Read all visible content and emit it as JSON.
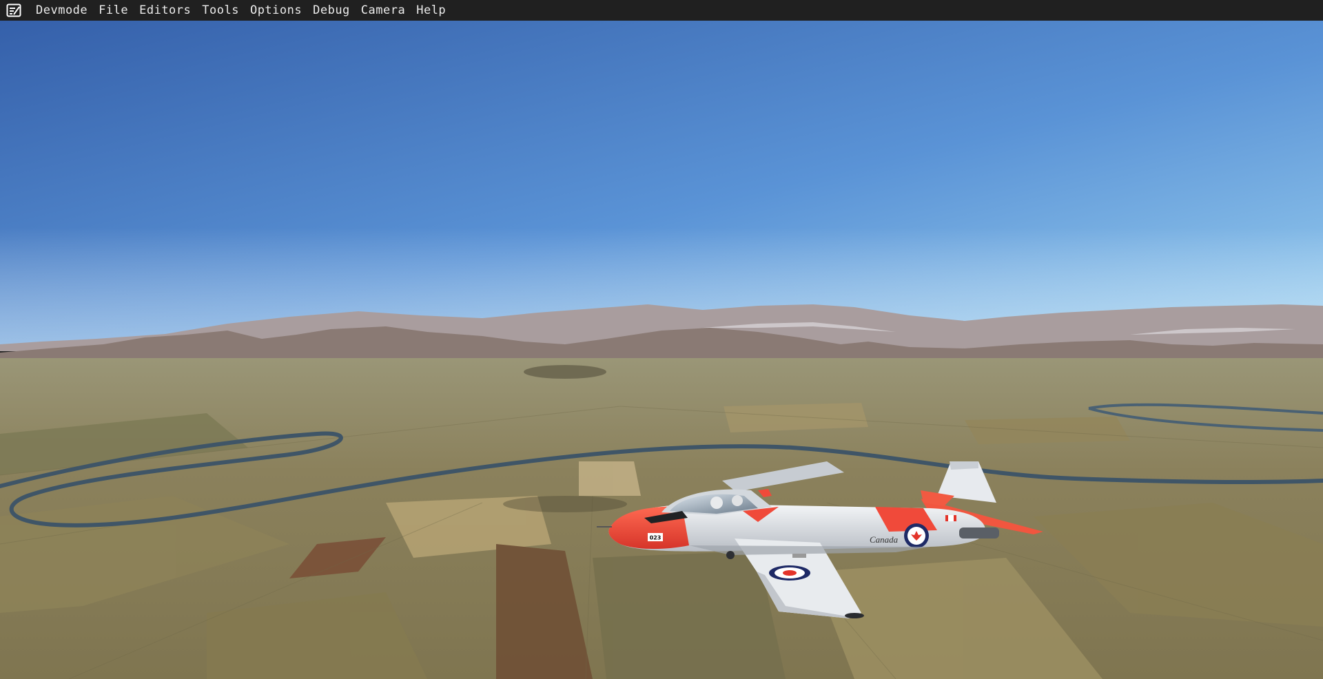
{
  "window": {
    "menubar": {
      "logo_icon": "devmode-notepad-icon",
      "items": [
        {
          "label": "Devmode"
        },
        {
          "label": "File"
        },
        {
          "label": "Editors"
        },
        {
          "label": "Tools"
        },
        {
          "label": "Options"
        },
        {
          "label": "Debug"
        },
        {
          "label": "Camera"
        },
        {
          "label": "Help"
        }
      ]
    }
  },
  "scene": {
    "sky_top_color": "#3a66b0",
    "sky_bottom_color": "#86c1ea",
    "mountain_color": "#8a7a78",
    "ground_color": "#8a7f58",
    "river_color": "#40566a",
    "aircraft": {
      "nose_code": "023",
      "fuselage_text": "Canada",
      "livery_primary": "#e9ebee",
      "livery_accent": "#f04a3a"
    }
  }
}
